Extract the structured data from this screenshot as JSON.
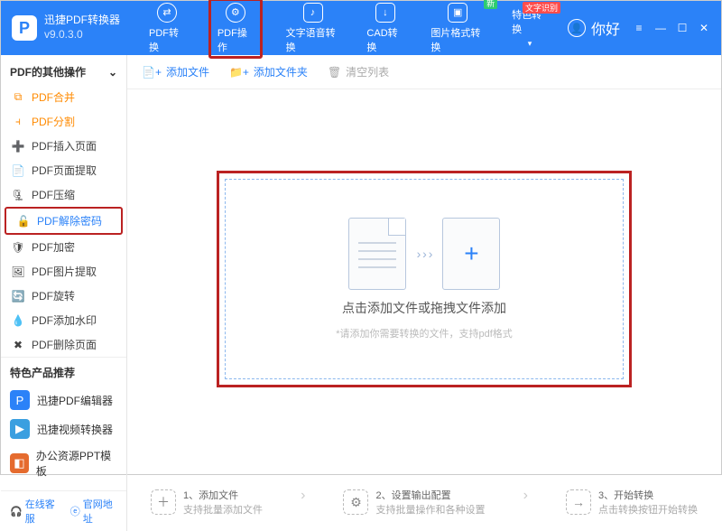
{
  "header": {
    "app_name": "迅捷PDF转换器",
    "version": "v9.0.3.0",
    "nav": [
      {
        "label": "PDF转换"
      },
      {
        "label": "PDF操作"
      },
      {
        "label": "文字语音转换"
      },
      {
        "label": "CAD转换"
      },
      {
        "label": "图片格式转换",
        "badge": "新"
      },
      {
        "label": "特色转换",
        "badge": "文字识别"
      }
    ],
    "user_label": "你好"
  },
  "sidebar": {
    "section_title": "PDF的其他操作",
    "items": [
      {
        "icon": "⧉",
        "label": "PDF合并"
      },
      {
        "icon": "⫞",
        "label": "PDF分割"
      },
      {
        "icon": "➕",
        "label": "PDF插入页面"
      },
      {
        "icon": "📄",
        "label": "PDF页面提取"
      },
      {
        "icon": "🗜",
        "label": "PDF压缩"
      },
      {
        "icon": "🔓",
        "label": "PDF解除密码"
      },
      {
        "icon": "🛡",
        "label": "PDF加密"
      },
      {
        "icon": "🖼",
        "label": "PDF图片提取"
      },
      {
        "icon": "🔄",
        "label": "PDF旋转"
      },
      {
        "icon": "💧",
        "label": "PDF添加水印"
      },
      {
        "icon": "✖",
        "label": "PDF删除页面"
      }
    ],
    "rec_title": "特色产品推荐",
    "recs": [
      {
        "color": "#2b82f8",
        "glyph": "P",
        "label": "迅捷PDF编辑器"
      },
      {
        "color": "#3a9fe0",
        "glyph": "▶",
        "label": "迅捷视频转换器"
      },
      {
        "color": "#e56b2e",
        "glyph": "◧",
        "label": "办公资源PPT模板"
      }
    ],
    "footer": {
      "support": "在线客服",
      "site": "官网地址"
    }
  },
  "toolbar": {
    "add_file": "添加文件",
    "add_folder": "添加文件夹",
    "clear_list": "清空列表"
  },
  "dropzone": {
    "title": "点击添加文件或拖拽文件添加",
    "sub": "*请添加你需要转换的文件，支持pdf格式"
  },
  "steps": [
    {
      "t": "1、添加文件",
      "d": "支持批量添加文件"
    },
    {
      "t": "2、设置输出配置",
      "d": "支持批量操作和各种设置"
    },
    {
      "t": "3、开始转换",
      "d": "点击转换按钮开始转换"
    }
  ]
}
